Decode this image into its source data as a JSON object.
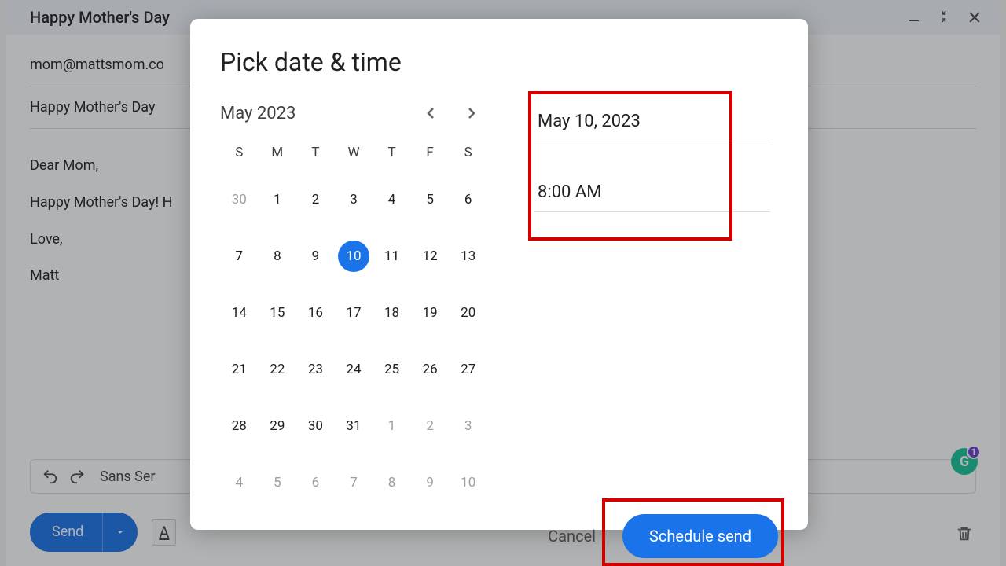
{
  "compose": {
    "window_title": "Happy Mother's Day",
    "to": "mom@mattsmom.co",
    "subject": "Happy Mother's Day",
    "body_lines": [
      "Dear Mom,",
      "Happy Mother's Day! H",
      "Love,",
      "Matt"
    ],
    "font_label": "Sans Ser",
    "send_label": "Send",
    "format_a": "A"
  },
  "grammarly_badge": "1",
  "dialog": {
    "title": "Pick date & time",
    "month_label": "May 2023",
    "dow": [
      "S",
      "M",
      "T",
      "W",
      "T",
      "F",
      "S"
    ],
    "days": [
      {
        "n": "30",
        "gray": true
      },
      {
        "n": "1"
      },
      {
        "n": "2"
      },
      {
        "n": "3"
      },
      {
        "n": "4"
      },
      {
        "n": "5"
      },
      {
        "n": "6"
      },
      {
        "n": "7"
      },
      {
        "n": "8"
      },
      {
        "n": "9"
      },
      {
        "n": "10",
        "selected": true
      },
      {
        "n": "11"
      },
      {
        "n": "12"
      },
      {
        "n": "13"
      },
      {
        "n": "14"
      },
      {
        "n": "15"
      },
      {
        "n": "16"
      },
      {
        "n": "17"
      },
      {
        "n": "18"
      },
      {
        "n": "19"
      },
      {
        "n": "20"
      },
      {
        "n": "21"
      },
      {
        "n": "22"
      },
      {
        "n": "23"
      },
      {
        "n": "24"
      },
      {
        "n": "25"
      },
      {
        "n": "26"
      },
      {
        "n": "27"
      },
      {
        "n": "28"
      },
      {
        "n": "29"
      },
      {
        "n": "30"
      },
      {
        "n": "31"
      },
      {
        "n": "1",
        "gray": true
      },
      {
        "n": "2",
        "gray": true
      },
      {
        "n": "3",
        "gray": true
      },
      {
        "n": "4",
        "gray": true
      },
      {
        "n": "5",
        "gray": true
      },
      {
        "n": "6",
        "gray": true
      },
      {
        "n": "7",
        "gray": true
      },
      {
        "n": "8",
        "gray": true
      },
      {
        "n": "9",
        "gray": true
      },
      {
        "n": "10",
        "gray": true
      }
    ],
    "date_value": "May 10, 2023",
    "time_value": "8:00 AM",
    "cancel_label": "Cancel",
    "schedule_label": "Schedule send"
  }
}
